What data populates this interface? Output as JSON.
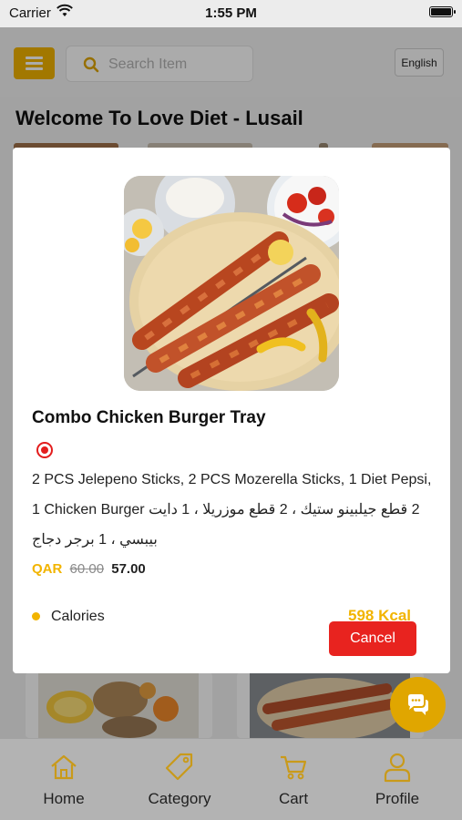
{
  "status_bar": {
    "carrier": "Carrier",
    "time": "1:55 PM"
  },
  "header": {
    "search_placeholder": "Search Item",
    "language_label": "English"
  },
  "page": {
    "welcome_title": "Welcome To Love Diet - Lusail"
  },
  "modal": {
    "item_name": "Combo Chicken Burger Tray",
    "description_en": "2 PCS Jelepeno Sticks, 2 PCS Mozerella Sticks, 1 Diet Pepsi, 1 Chicken Burger",
    "description_ar": "2 قطع جيلبينو ستيك ، 2 قطع موزريلا ، 1 دايت بيبسي ، 1 برجر دجاج",
    "currency": "QAR",
    "old_price": "60.00",
    "new_price": "57.00",
    "nutrition_label": "Calories",
    "nutrition_value": "598 Kcal",
    "cancel_label": "Cancel"
  },
  "bottom_nav": {
    "items": [
      {
        "label": "Home",
        "icon": "home-icon"
      },
      {
        "label": "Category",
        "icon": "tag-icon"
      },
      {
        "label": "Cart",
        "icon": "cart-icon"
      },
      {
        "label": "Profile",
        "icon": "user-icon"
      }
    ]
  },
  "colors": {
    "accent": "#f2b400",
    "cancel": "#e8231f",
    "nav_background": "#b3b3b3"
  }
}
